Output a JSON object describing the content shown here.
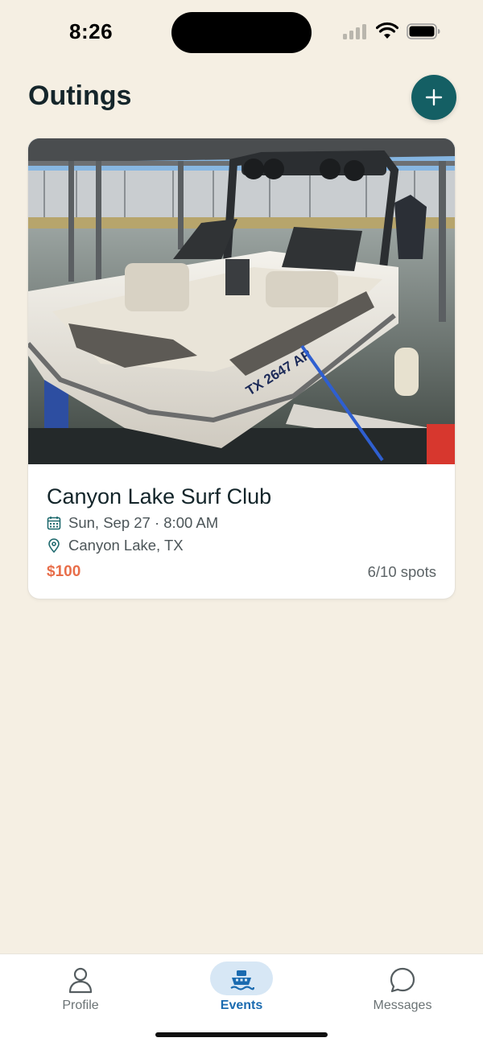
{
  "status_bar": {
    "time": "8:26"
  },
  "header": {
    "title": "Outings",
    "add_icon": "plus-icon"
  },
  "events": [
    {
      "title": "Canyon Lake Surf Club",
      "date": "Sun, Sep 27 · 8:00 AM",
      "location": "Canyon Lake, TX",
      "price": "$100",
      "spots": "6/10 spots",
      "image": "wake boat on lift in covered marina",
      "boat_registration": "TX 2647 AP"
    }
  ],
  "tab_bar": {
    "tabs": [
      {
        "label": "Profile",
        "icon": "person-icon",
        "active": false
      },
      {
        "label": "Events",
        "icon": "boat-icon",
        "active": true
      },
      {
        "label": "Messages",
        "icon": "chat-bubble-icon",
        "active": false
      }
    ]
  },
  "colors": {
    "background": "#f5efe3",
    "accent": "#145f64",
    "price": "#e86e4a",
    "active_tab": "#1b6bb0"
  }
}
